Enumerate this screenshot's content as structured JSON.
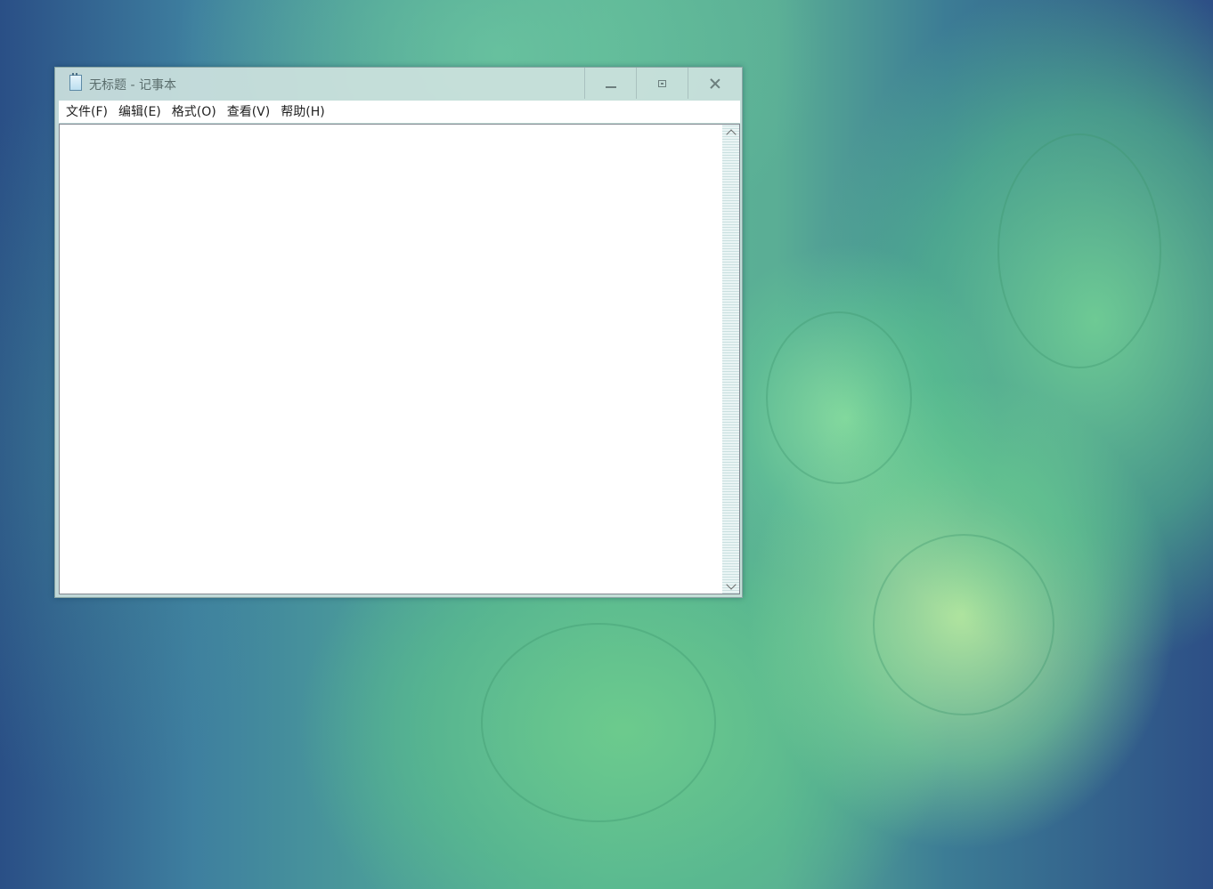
{
  "window": {
    "title": "无标题 - 记事本",
    "icon": "notepad-icon",
    "buttons": {
      "minimize_icon": "minimize-icon",
      "maximize_icon": "maximize-icon",
      "close_icon": "close-icon"
    }
  },
  "menu": {
    "items": [
      {
        "label": "文件(F)"
      },
      {
        "label": "编辑(E)"
      },
      {
        "label": "格式(O)"
      },
      {
        "label": "查看(V)"
      },
      {
        "label": "帮助(H)"
      }
    ]
  },
  "editor": {
    "text": ""
  },
  "colors": {
    "desktop_primary": "#5ab396",
    "desktop_edge": "#2a4f86",
    "window_frame": "#cde2de"
  }
}
